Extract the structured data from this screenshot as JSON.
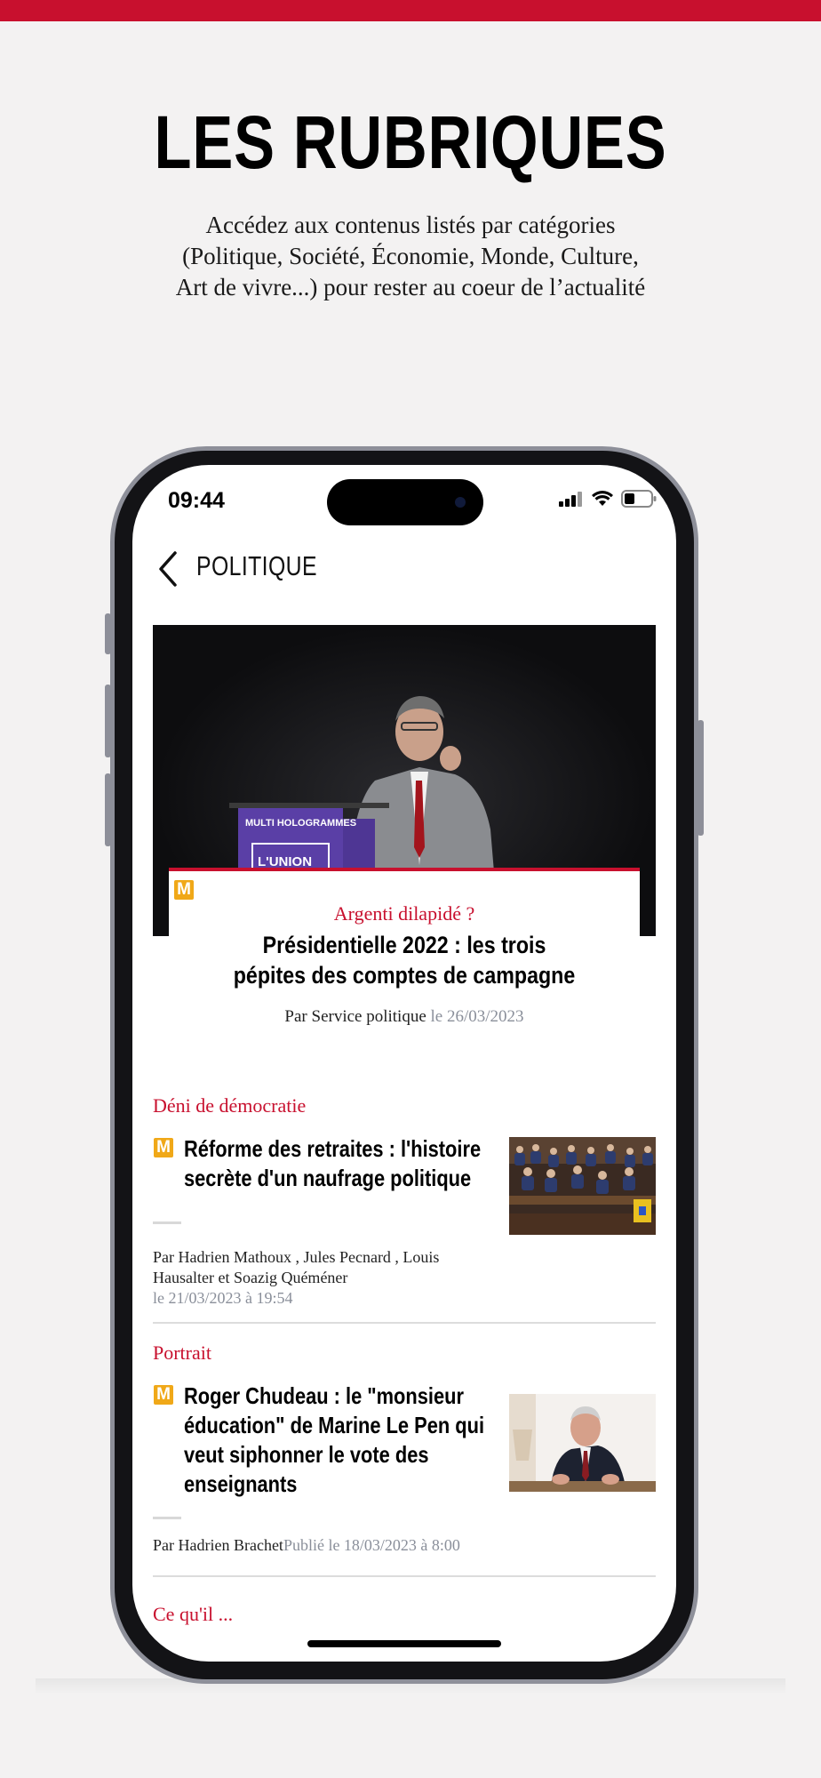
{
  "promo": {
    "title": "LES RUBRIQUES",
    "subtitle_lines": [
      "Accédez aux contenus listés par catégories",
      "(Politique, Société, Économie, Monde, Culture,",
      "Art de vivre...) pour rester au coeur de l’actualité"
    ]
  },
  "status_bar": {
    "time": "09:44"
  },
  "nav": {
    "title": "POLITIQUE"
  },
  "lead": {
    "badge": "M",
    "kicker": "Argenti dilapidé ?",
    "title_lines": [
      "Présidentielle 2022 : les trois",
      "pépites des comptes de campagne"
    ],
    "byline": "Par Service politique",
    "date": "le 26/03/2023",
    "podium_text": [
      "MULTI HOLOGRAMMES",
      "L'UNION"
    ]
  },
  "articles": [
    {
      "section": "Déni de démocratie",
      "badge": "M",
      "title_lines": [
        "Réforme des retraites : l'histoire",
        "secrète d'un naufrage politique"
      ],
      "byline_lines": [
        "Par Hadrien Mathoux , Jules Pecnard , Louis",
        "Hausalter et Soazig Quéméner"
      ],
      "date": "le 21/03/2023 à 19:54"
    },
    {
      "section": "Portrait",
      "badge": "M",
      "title_lines": [
        "Roger Chudeau : le \"monsieur",
        "éducation\" de Marine Le Pen qui",
        "veut siphonner le vote des",
        "enseignants"
      ],
      "byline": "Par Hadrien Brachet",
      "date": "Publié le 18/03/2023 à 8:00"
    }
  ],
  "next_section_partial": "Ce qu'il ...",
  "colors": {
    "accent": "#c8102e",
    "badge": "#f0a818",
    "muted": "#8a8f9a",
    "frame": "#8d8f99"
  }
}
